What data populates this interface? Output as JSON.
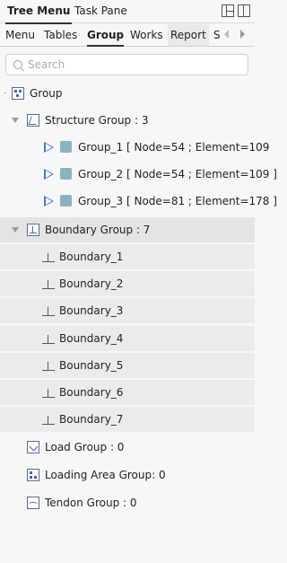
{
  "window": {
    "tabs": [
      "Tree Menu",
      "Task Pane"
    ]
  },
  "subtabs": [
    "Menu",
    "Tables",
    "Group",
    "Works",
    "Report",
    "S"
  ],
  "search": {
    "placeholder": "Search",
    "value": ""
  },
  "tree": {
    "root": "Group",
    "structure_group": {
      "label": "Structure Group : 3",
      "items": [
        "Group_1 [ Node=54 ; Element=109",
        "Group_2 [ Node=54 ; Element=109 ]",
        "Group_3 [ Node=81 ; Element=178 ]"
      ],
      "swatch_color": "#8ab3c2"
    },
    "boundary_group": {
      "label": "Boundary Group : 7",
      "items": [
        "Boundary_1",
        "Boundary_2",
        "Boundary_3",
        "Boundary_4",
        "Boundary_5",
        "Boundary_6",
        "Boundary_7"
      ]
    },
    "load_group": "Load Group : 0",
    "loading_area_group": "Loading Area Group: 0",
    "tendon_group": "Tendon Group : 0"
  },
  "colors": {
    "accent": "#4a78d0",
    "selection": "#e4e4e4"
  }
}
